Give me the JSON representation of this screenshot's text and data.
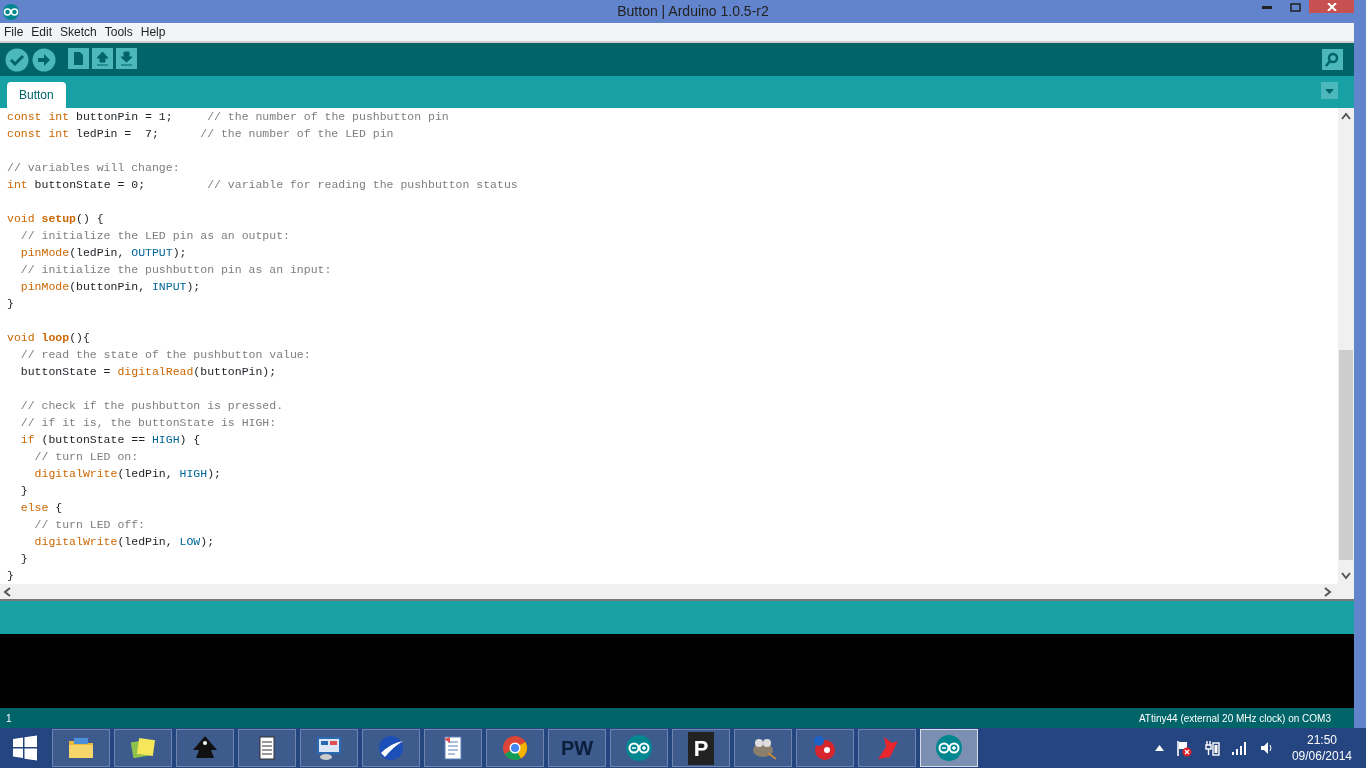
{
  "window": {
    "title": "Button | Arduino 1.0.5-r2"
  },
  "menu": [
    "File",
    "Edit",
    "Sketch",
    "Tools",
    "Help"
  ],
  "toolbar": [
    {
      "kind": "verify"
    },
    {
      "kind": "upload"
    },
    {
      "kind": "new"
    },
    {
      "kind": "open"
    },
    {
      "kind": "save"
    }
  ],
  "tabs": [
    {
      "label": "Button",
      "selected": true
    }
  ],
  "editor": {
    "lines": [
      {
        "segments": [
          {
            "text": "const",
            "kind": "keyword"
          },
          {
            "text": " int",
            "kind": "keyword"
          },
          {
            "text": " buttonPin = 1;     "
          },
          {
            "text": "// the number of the pushbutton pin",
            "kind": "comment"
          }
        ]
      },
      {
        "segments": [
          {
            "text": "const",
            "kind": "keyword"
          },
          {
            "text": " int",
            "kind": "keyword"
          },
          {
            "text": " ledPin =  7;      "
          },
          {
            "text": "// the number of the LED pin",
            "kind": "comment"
          }
        ]
      },
      {
        "gap_before": true,
        "segments": [
          {
            "text": "// variables will change:",
            "kind": "comment"
          }
        ]
      },
      {
        "segments": [
          {
            "text": "int",
            "kind": "keyword"
          },
          {
            "text": " buttonState = 0;         "
          },
          {
            "text": "// variable for reading the pushbutton status",
            "kind": "comment"
          }
        ]
      },
      {
        "gap_before": true,
        "segments": [
          {
            "text": "void",
            "kind": "keyword"
          },
          {
            "text": " setup",
            "kind": "function_bold"
          },
          {
            "text": "() {"
          }
        ]
      },
      {
        "segments": [
          {
            "text": "  // initialize the LED pin as an output:",
            "kind": "comment"
          }
        ]
      },
      {
        "segments": [
          {
            "text": "  pinMode",
            "kind": "function"
          },
          {
            "text": "(ledPin, "
          },
          {
            "text": "OUTPUT",
            "kind": "constant"
          },
          {
            "text": ");"
          }
        ]
      },
      {
        "segments": [
          {
            "text": "  // initialize the pushbutton pin as an input:",
            "kind": "comment"
          }
        ]
      },
      {
        "segments": [
          {
            "text": "  pinMode",
            "kind": "function"
          },
          {
            "text": "(buttonPin, "
          },
          {
            "text": "INPUT",
            "kind": "constant"
          },
          {
            "text": ");"
          }
        ]
      },
      {
        "segments": [
          {
            "text": "}"
          }
        ]
      },
      {
        "gap_before": true,
        "segments": [
          {
            "text": "void",
            "kind": "keyword"
          },
          {
            "text": " loop",
            "kind": "function_bold"
          },
          {
            "text": "(){"
          }
        ]
      },
      {
        "segments": [
          {
            "text": "  // read the state of the pushbutton value:",
            "kind": "comment"
          }
        ]
      },
      {
        "segments": [
          {
            "text": "  buttonState = "
          },
          {
            "text": "digitalRead",
            "kind": "function"
          },
          {
            "text": "(buttonPin);"
          }
        ]
      },
      {
        "gap_before": true,
        "segments": [
          {
            "text": "  // check if the pushbutton is pressed.",
            "kind": "comment"
          }
        ]
      },
      {
        "segments": [
          {
            "text": "  // if it is, the buttonState is HIGH:",
            "kind": "comment"
          }
        ]
      },
      {
        "segments": [
          {
            "text": "  if",
            "kind": "keyword"
          },
          {
            "text": " (buttonState == "
          },
          {
            "text": "HIGH",
            "kind": "constant"
          },
          {
            "text": ") {"
          }
        ]
      },
      {
        "segments": [
          {
            "text": "    // turn LED on:",
            "kind": "comment"
          }
        ]
      },
      {
        "segments": [
          {
            "text": "    digitalWrite",
            "kind": "function"
          },
          {
            "text": "(ledPin, "
          },
          {
            "text": "HIGH",
            "kind": "constant"
          },
          {
            "text": ");"
          }
        ]
      },
      {
        "segments": [
          {
            "text": "  }"
          }
        ]
      },
      {
        "segments": [
          {
            "text": "  else",
            "kind": "keyword"
          },
          {
            "text": " {"
          }
        ]
      },
      {
        "segments": [
          {
            "text": "    // turn LED off:",
            "kind": "comment"
          }
        ]
      },
      {
        "segments": [
          {
            "text": "    digitalWrite",
            "kind": "function"
          },
          {
            "text": "(ledPin, "
          },
          {
            "text": "LOW",
            "kind": "constant"
          },
          {
            "text": ");"
          }
        ]
      },
      {
        "segments": [
          {
            "text": "  }"
          }
        ]
      },
      {
        "segments": [
          {
            "text": "}"
          }
        ]
      }
    ]
  },
  "status_bar": {
    "line": "1",
    "board": "ATtiny44 (external 20 MHz clock) on COM3"
  },
  "taskbar": {
    "items": [
      {
        "kind": "folder",
        "selected": false
      },
      {
        "kind": "notes",
        "selected": false
      },
      {
        "kind": "pen",
        "selected": false
      },
      {
        "kind": "archive",
        "selected": false
      },
      {
        "kind": "monitor",
        "selected": false
      },
      {
        "kind": "globe",
        "selected": false
      },
      {
        "kind": "document",
        "selected": false
      },
      {
        "kind": "chrome",
        "selected": false
      },
      {
        "kind": "text",
        "label": "PW",
        "selected": false
      },
      {
        "kind": "arduino",
        "selected": false
      },
      {
        "kind": "text",
        "label": "P",
        "selected": false
      },
      {
        "kind": "gimp",
        "selected": false
      },
      {
        "kind": "flower",
        "selected": false
      },
      {
        "kind": "bird",
        "selected": false
      },
      {
        "kind": "arduino",
        "selected": true
      }
    ],
    "time": "21:50",
    "date": "09/06/2014"
  }
}
